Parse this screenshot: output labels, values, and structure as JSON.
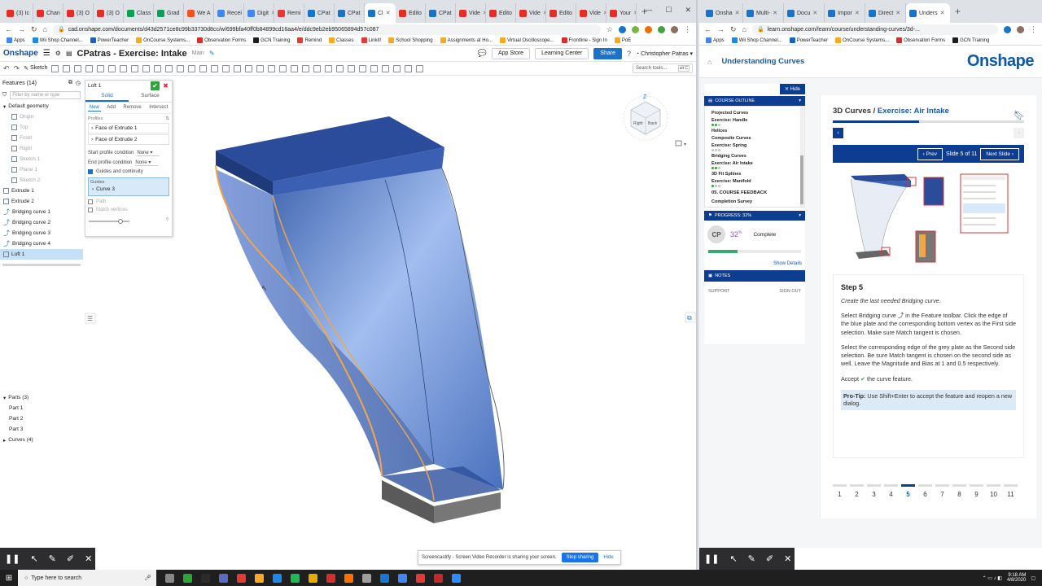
{
  "left": {
    "tabs": [
      {
        "label": "(3) Ic",
        "color": "#e52d27"
      },
      {
        "label": "Chan",
        "color": "#e52d27"
      },
      {
        "label": "(3) O",
        "color": "#e52d27"
      },
      {
        "label": "(3) O",
        "color": "#e52d27"
      },
      {
        "label": "Class",
        "color": "#0f9d58"
      },
      {
        "label": "Grad",
        "color": "#0f9d58"
      },
      {
        "label": "We A",
        "color": "#f4511e"
      },
      {
        "label": "Recei",
        "color": "#4285f4"
      },
      {
        "label": "Digit",
        "color": "#4285f4"
      },
      {
        "label": "Remi",
        "color": "#e53935"
      },
      {
        "label": "CPat",
        "color": "#1a73c9"
      },
      {
        "label": "CPat",
        "color": "#1a73c9"
      },
      {
        "label": "Cl",
        "color": "#1a73c9",
        "active": true
      },
      {
        "label": "Edito",
        "color": "#e52d27"
      },
      {
        "label": "CPat",
        "color": "#1a73c9"
      },
      {
        "label": "Vide",
        "color": "#e52d27"
      },
      {
        "label": "Edito",
        "color": "#e52d27"
      },
      {
        "label": "Vide",
        "color": "#e52d27"
      },
      {
        "label": "Edito",
        "color": "#e52d27"
      },
      {
        "label": "Vide",
        "color": "#e52d27"
      },
      {
        "label": "Your",
        "color": "#e52d27"
      }
    ],
    "url": "cad.onshape.com/documents/d43d2571ce8c99b33730d8cc/w/699bfa40ff0b84899cd16aa4/e/ddc9eb2eb95065894d57c087",
    "bookmarks": [
      {
        "label": "Apps",
        "color": "#4285f4"
      },
      {
        "label": "Wii Shop Channel...",
        "color": "#1e88e5"
      },
      {
        "label": "PowerTeacher",
        "color": "#1565c0"
      },
      {
        "label": "OnCourse Systems...",
        "color": "#f9a825"
      },
      {
        "label": "Observation Forms",
        "color": "#d32f2f"
      },
      {
        "label": "GCN Training",
        "color": "#1e1e1e"
      },
      {
        "label": "Remind",
        "color": "#e53935"
      },
      {
        "label": "Classes",
        "color": "#f9a825"
      },
      {
        "label": "Linkit!",
        "color": "#e53935"
      },
      {
        "label": "School Shopping",
        "color": "#f9a825"
      },
      {
        "label": "Assignments at Ho...",
        "color": "#f9a825"
      },
      {
        "label": "Virtual Oscilloscope...",
        "color": "#f9a825"
      },
      {
        "label": "Frontline - Sign In",
        "color": "#d32f2f"
      },
      {
        "label": "PoE",
        "color": "#f9a825"
      }
    ],
    "app": {
      "logo": "Onshape",
      "doc_title": "CPatras - Exercise: Intake",
      "workspace": "Main",
      "app_store": "App Store",
      "learning_center": "Learning Center",
      "share": "Share",
      "user": "Christopher Patras",
      "sketch": "Sketch",
      "search_tools": "Search tools...",
      "search_shortcut": "alt C"
    },
    "feature_list": {
      "header": "Features (14)",
      "filter_placeholder": "Filter by name or type",
      "items": [
        {
          "label": "Default geometry",
          "kind": "group"
        },
        {
          "label": "Origin",
          "kind": "dim"
        },
        {
          "label": "Top",
          "kind": "dim"
        },
        {
          "label": "Front",
          "kind": "dim"
        },
        {
          "label": "Right",
          "kind": "dim"
        },
        {
          "label": "Sketch 1",
          "kind": "dim"
        },
        {
          "label": "Plane 1",
          "kind": "dim"
        },
        {
          "label": "Sketch 2",
          "kind": "dim"
        },
        {
          "label": "Extrude 1",
          "kind": "feat"
        },
        {
          "label": "Extrude 2",
          "kind": "feat"
        },
        {
          "label": "Bridging curve 1",
          "kind": "curve"
        },
        {
          "label": "Bridging curve 2",
          "kind": "curve"
        },
        {
          "label": "Bridging curve 3",
          "kind": "curve"
        },
        {
          "label": "Bridging curve 4",
          "kind": "curve"
        },
        {
          "label": "Loft 1",
          "kind": "sel"
        }
      ],
      "parts_header": "Parts (3)",
      "parts": [
        "Part 1",
        "Part 2",
        "Part 3"
      ],
      "curves": "Curves (4)"
    },
    "loft_dialog": {
      "title": "Loft 1",
      "tab_solid": "Solid",
      "tab_surface": "Surface",
      "ops": [
        "New",
        "Add",
        "Remove",
        "Intersect"
      ],
      "profiles_label": "Profiles",
      "profiles": [
        "Face of Extrude 1",
        "Face of Extrude 2"
      ],
      "start_label": "Start profile condition",
      "start_value": "None",
      "end_label": "End profile condition",
      "end_value": "None",
      "guides_continuity": "Guides and continuity",
      "guides_label": "Guides",
      "guide_value": "Curve 3",
      "path": "Path",
      "match_vertices": "Match vertices"
    },
    "viewcube": {
      "top": "Z",
      "front": "Right",
      "back": "Back"
    },
    "share_bar": {
      "text": "Screencastify - Screen Video Recorder is sharing your screen.",
      "stop": "Stop sharing",
      "hide": "Hide"
    }
  },
  "right": {
    "tabs": [
      {
        "label": "Onsha",
        "color": "#1a73c9"
      },
      {
        "label": "Multi-",
        "color": "#1a73c9"
      },
      {
        "label": "Docu",
        "color": "#1a73c9"
      },
      {
        "label": "Impor",
        "color": "#1a73c9"
      },
      {
        "label": "Direct",
        "color": "#1a73c9"
      },
      {
        "label": "Unders",
        "color": "#1a73c9",
        "active": true
      }
    ],
    "url": "learn.onshape.com/learn/course/understanding-curves/3d-...",
    "bookmarks": [
      {
        "label": "Apps",
        "color": "#4285f4"
      },
      {
        "label": "Wii Shop Channel...",
        "color": "#1e88e5"
      },
      {
        "label": "PowerTeacher",
        "color": "#1565c0"
      },
      {
        "label": "OnCourse Systems...",
        "color": "#f9a825"
      },
      {
        "label": "Observation Forms",
        "color": "#d32f2f"
      },
      {
        "label": "GCN Training",
        "color": "#1e1e1e"
      }
    ],
    "page_title": "Understanding Curves",
    "logo": "Onshape",
    "outline": {
      "hide": "Hide",
      "header": "COURSE OUTLINE",
      "items": [
        {
          "label": "Projected Curves",
          "dots": []
        },
        {
          "label": "Exercise: Handle",
          "dots": [
            "g",
            "g",
            "o"
          ]
        },
        {
          "label": "Helices",
          "dots": []
        },
        {
          "label": "Composite Curves",
          "dots": []
        },
        {
          "label": "Exercise: Spring",
          "dots": [
            "o",
            "o",
            "o"
          ]
        },
        {
          "label": "Bridging Curves",
          "dots": []
        },
        {
          "label": "Exercise: Air Intake",
          "dots": [
            "g",
            "g",
            "o"
          ]
        },
        {
          "label": "3D Fit Splines",
          "dots": []
        },
        {
          "label": "Exercise: Manifold",
          "dots": [
            "g",
            "o",
            "o"
          ]
        }
      ],
      "section": "05. COURSE FEEDBACK",
      "survey": "Completion Survey",
      "progress_header": "PROGRESS: 32%",
      "initials": "CP",
      "percent": "32",
      "percent_sign": "%",
      "status": "Complete",
      "progress": 0.32,
      "show_details": "Show Details",
      "notes": "NOTES",
      "support": "SUPPORT",
      "signout": "SIGN OUT"
    },
    "lesson": {
      "title_prefix": "3D Curves / ",
      "title_link": "Exercise: Air Intake",
      "slider_progress": 0.45,
      "prev": "Prev",
      "slide_count": "Slide 5 of 11",
      "next": "Next Slide",
      "step": "Step 5",
      "intro": "Create the last needed Bridging curve.",
      "p1": "Select Bridging curve ⤴ in the Feature toolbar. Click the edge of the blue plate and the corresponding bottom vertex as the First side selection. Make sure Match tangent is chosen.",
      "p2": "Select the corresponding edge of the grey plate as the Second side selection. Be sure Match tangent is chosen on the second side as well. Leave the Magnitude and Bias at 1 and 0.5 respectively.",
      "p3_prefix": "Accept",
      "p3_suffix": "the curve feature.",
      "tip_label": "Pro-Tip:",
      "tip_text": " Use Shift+Enter to accept the feature and reopen a new dialog.",
      "pages": [
        "1",
        "2",
        "3",
        "4",
        "5",
        "6",
        "7",
        "8",
        "9",
        "10",
        "11"
      ],
      "current_page": "5"
    }
  },
  "taskbar": {
    "search_placeholder": "Type here to search",
    "time": "9:18 AM",
    "date": "4/8/2020"
  },
  "colors": {
    "onshape_blue": "#0c3d91",
    "accent": "#1a73c9",
    "part_blue": "#3b64b8",
    "highlight_orange": "#f0a64a"
  }
}
